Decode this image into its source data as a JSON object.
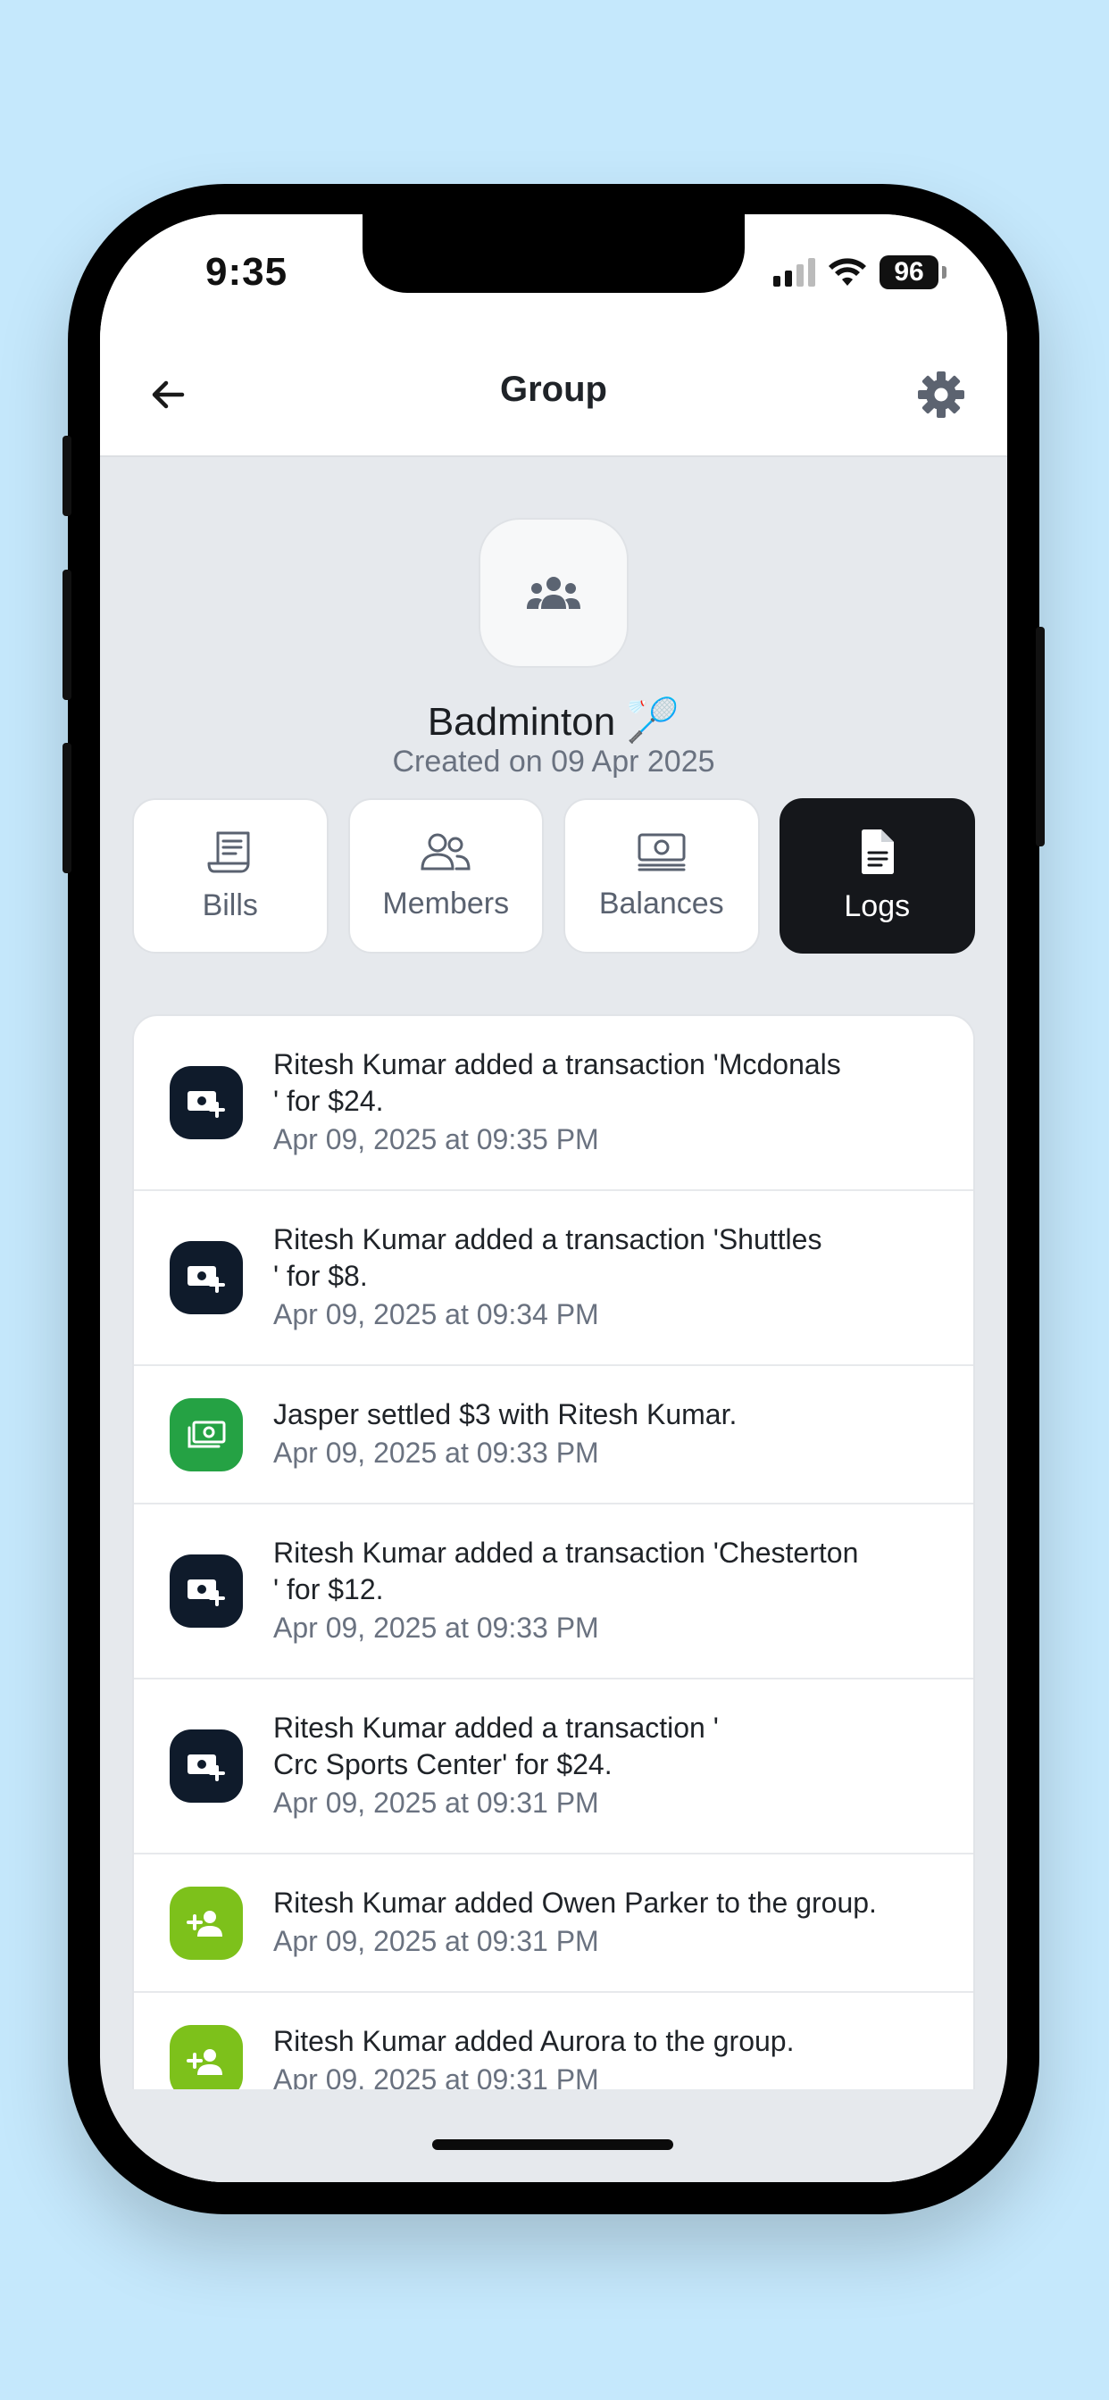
{
  "status_bar": {
    "time": "9:35",
    "battery": "96"
  },
  "header": {
    "title": "Group"
  },
  "group": {
    "name": "Badminton",
    "emoji": "🏸",
    "created": "Created on 09 Apr 2025"
  },
  "tabs": [
    {
      "label": "Bills",
      "icon": "receipt-icon"
    },
    {
      "label": "Members",
      "icon": "users-icon"
    },
    {
      "label": "Balances",
      "icon": "money-icon"
    },
    {
      "label": "Logs",
      "icon": "document-icon",
      "active": true
    }
  ],
  "logs": [
    {
      "message": "Ritesh Kumar added a transaction 'Mcdonals\n' for $24.",
      "time": "Apr 09, 2025 at 09:35 PM",
      "icon": "money-add-icon",
      "color": "#0f1b2b"
    },
    {
      "message": "Ritesh Kumar added a transaction 'Shuttles\n' for $8.",
      "time": "Apr 09, 2025 at 09:34 PM",
      "icon": "money-add-icon",
      "color": "#0f1b2b"
    },
    {
      "message": "Jasper settled $3 with Ritesh Kumar.",
      "time": "Apr 09, 2025 at 09:33 PM",
      "icon": "money-settle-icon",
      "color": "#25a244"
    },
    {
      "message": "Ritesh Kumar added a transaction 'Chesterton\n' for $12.",
      "time": "Apr 09, 2025 at 09:33 PM",
      "icon": "money-add-icon",
      "color": "#0f1b2b"
    },
    {
      "message": "Ritesh Kumar added a transaction '\nCrc Sports Center' for $24.",
      "time": "Apr 09, 2025 at 09:31 PM",
      "icon": "money-add-icon",
      "color": "#0f1b2b"
    },
    {
      "message": "Ritesh Kumar added Owen Parker to the group.",
      "time": "Apr 09, 2025 at 09:31 PM",
      "icon": "user-add-icon",
      "color": "#7dc11b"
    },
    {
      "message": "Ritesh Kumar added Aurora to the group.",
      "time": "Apr 09, 2025 at 09:31 PM",
      "icon": "user-add-icon",
      "color": "#7dc11b"
    }
  ]
}
